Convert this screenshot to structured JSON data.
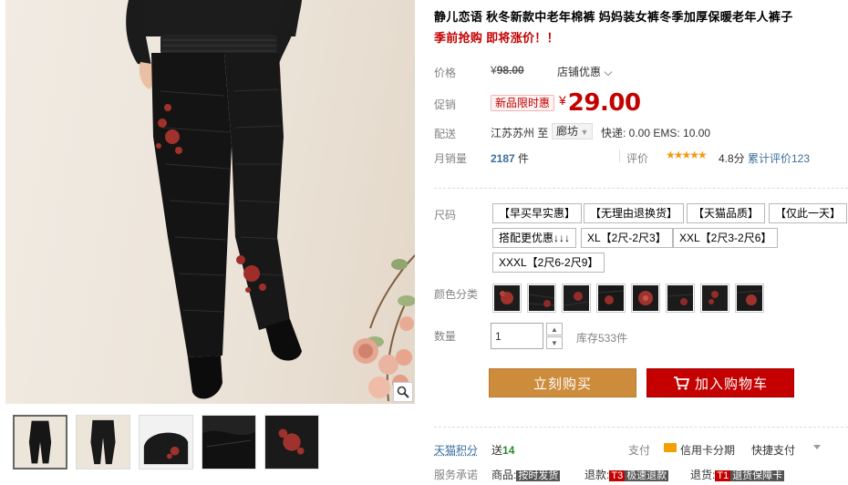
{
  "product": {
    "title": "静儿恋语 秋冬新款中老年棉裤 妈妈装女裤冬季加厚保暖老年人裤子",
    "subtitle": "季前抢购 即将涨价！！"
  },
  "price": {
    "label": "价格",
    "currency": "¥",
    "original": "98.00",
    "shop_discount": "店铺优惠",
    "promo_label": "促销",
    "promo_tag": "新品限时惠",
    "promo_price": "29.00"
  },
  "shipping": {
    "label": "配送",
    "from": "江苏苏州",
    "to_word": "至",
    "destination": "廊坊",
    "fee": "快递: 0.00 EMS: 10.00"
  },
  "sales": {
    "label": "月销量",
    "count": "2187",
    "unit": "件",
    "rating_label": "评价",
    "stars": "★★★★★",
    "rating": "4.8分",
    "review_link": "累计评价123"
  },
  "sku": {
    "size_label": "尺码",
    "sizes": [
      "【早买早实惠】",
      "【无理由退换货】",
      "【天猫品质】",
      "【仅此一天】",
      "搭配更优惠↓↓↓",
      "XL【2尺-2尺3】",
      "XXL【2尺3-2尺6】",
      "XXXL【2尺6-2尺9】"
    ],
    "color_label": "颜色分类",
    "color_count": 8
  },
  "quantity": {
    "label": "数量",
    "value": "1",
    "stock": "库存533件"
  },
  "actions": {
    "buy_now": "立刻购买",
    "add_cart": "加入购物车"
  },
  "points": {
    "label": "天猫积分",
    "prefix": "送",
    "value": "14"
  },
  "payment": {
    "label": "支付",
    "card": "信用卡分期",
    "quick": "快捷支付"
  },
  "service": {
    "label": "服务承诺",
    "items": [
      {
        "prefix": "商品:",
        "code": "",
        "text": "按时发货"
      },
      {
        "prefix": "退款:",
        "code": "T3",
        "text": "极速退款"
      },
      {
        "prefix": "退货:",
        "code": "T1",
        "text": "退货保障卡"
      }
    ]
  },
  "colors": {
    "accent": "#c40000",
    "buy": "#cd8b3c",
    "link": "#3a6f9e"
  }
}
